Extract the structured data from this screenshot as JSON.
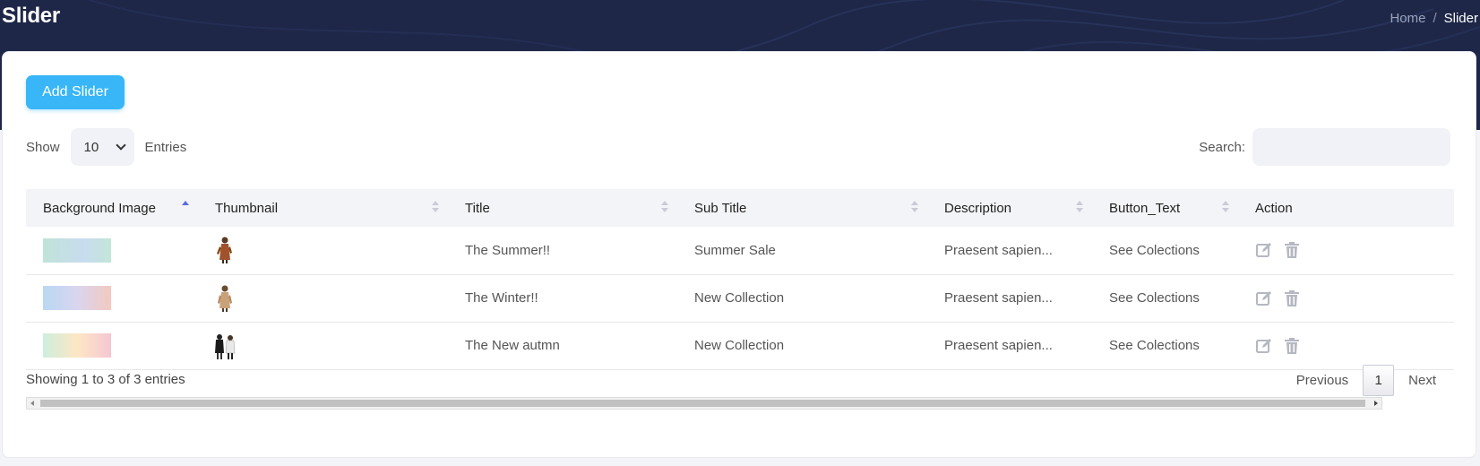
{
  "header": {
    "title": "Slider",
    "breadcrumb": [
      "Home",
      "Slider"
    ],
    "breadcrumb_separator": "/"
  },
  "toolbar": {
    "add_label": "Add Slider"
  },
  "length_menu": {
    "show_label": "Show",
    "selected": "10",
    "entries_label": "Entries"
  },
  "search": {
    "label": "Search:",
    "value": ""
  },
  "table": {
    "columns": [
      "Background Image",
      "Thumbnail",
      "Title",
      "Sub Title",
      "Description",
      "Button_Text",
      "Action"
    ],
    "sorted_column": "Background Image",
    "sort_direction": "ascending",
    "rows": [
      {
        "background_colors": [
          "#bfe3d8",
          "#c8dcef"
        ],
        "thumbnail": "person-brown-coat",
        "title": "The Summer!!",
        "sub_title": "Summer Sale",
        "description": "Praesent sapien...",
        "button_text": "See Colections"
      },
      {
        "background_colors": [
          "#b9d8f3",
          "#f3c9c0"
        ],
        "thumbnail": "person-tan-coat",
        "title": "The Winter!!",
        "sub_title": "New Collection",
        "description": "Praesent sapien...",
        "button_text": "See Colections"
      },
      {
        "background_colors": [
          "#cdeede",
          "#fde7c4",
          "#f6c6d3"
        ],
        "thumbnail": "two-people-black-white",
        "title": "The New autmn",
        "sub_title": "New Collection",
        "description": "Praesent sapien...",
        "button_text": "See Colections"
      }
    ]
  },
  "footer": {
    "info": "Showing 1 to 3 of 3 entries",
    "previous_label": "Previous",
    "current_page": "1",
    "next_label": "Next"
  },
  "colors": {
    "header_bg": "#1e2747",
    "accent": "#38b6f7",
    "sort_active": "#5a6be0"
  },
  "icons": [
    "edit-icon",
    "trash-icon",
    "sort-icon",
    "chevron-down-icon"
  ]
}
